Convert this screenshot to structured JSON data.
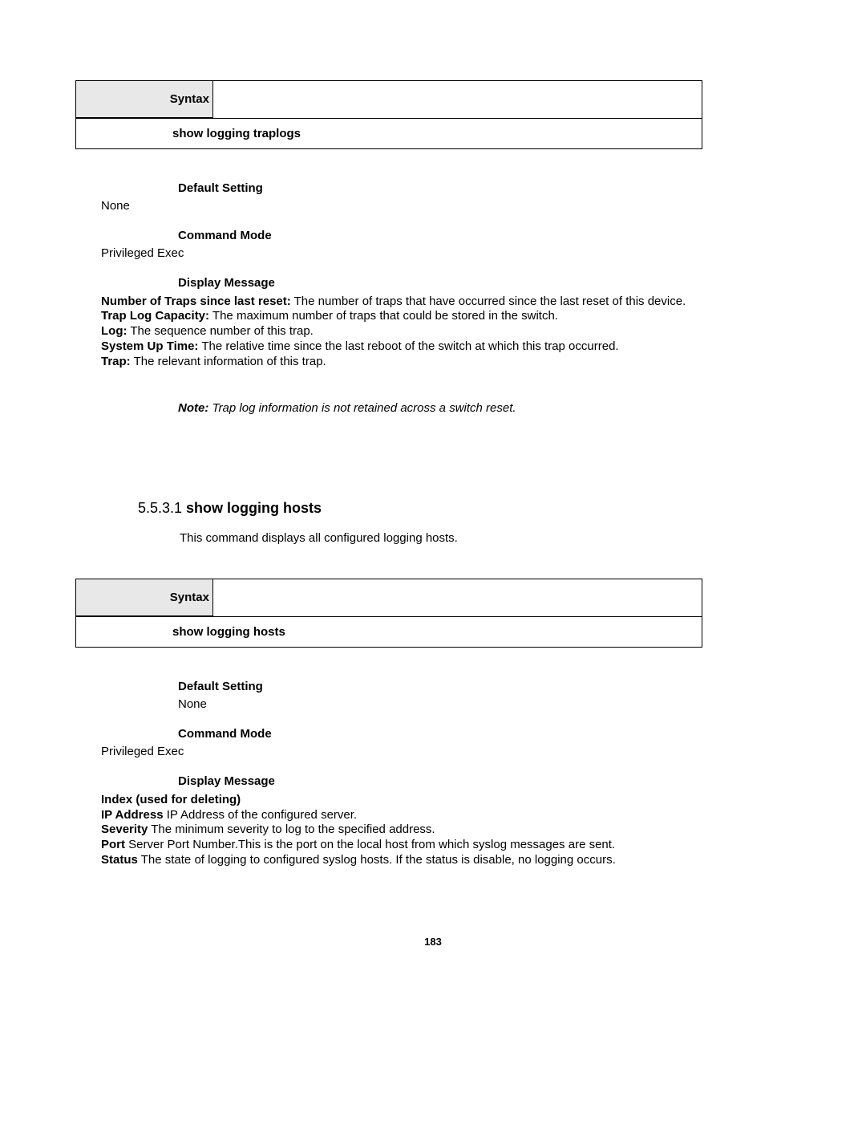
{
  "syntax1": {
    "label": "Syntax",
    "command": "show logging traplogs"
  },
  "default1": {
    "label": "Default Setting",
    "value": "None"
  },
  "mode1": {
    "label": "Command Mode",
    "value": "Privileged Exec"
  },
  "display1": {
    "label": "Display Message",
    "rows": {
      "num_traps_label": "Number of Traps since last reset:",
      "num_traps_text": " The number of traps that have occurred since the last reset of this device.",
      "capacity_label": "Trap Log Capacity:",
      "capacity_text": " The maximum number of traps that could be stored in the switch.",
      "log_label": "Log:",
      "log_text": " The sequence number of this trap.",
      "uptime_label": "System Up Time:",
      "uptime_text": " The relative time since the last reboot of the switch at which this trap occurred.",
      "trap_label": "Trap:",
      "trap_text": " The relevant information of this trap."
    }
  },
  "note": {
    "label": "Note:",
    "text": " Trap log information is not retained across a switch reset."
  },
  "subsection": {
    "number": "5.5.3.1 ",
    "title": "show logging hosts",
    "desc": "This command displays all configured logging hosts."
  },
  "syntax2": {
    "label": "Syntax",
    "command": "show logging hosts"
  },
  "default2": {
    "label": "Default Setting",
    "value": "None"
  },
  "mode2": {
    "label": "Command Mode",
    "value": "Privileged Exec"
  },
  "display2": {
    "label": "Display Message",
    "rows": {
      "index_label": "Index (used for deleting)",
      "ip_label": "IP Address",
      "ip_text": " IP Address of the configured server.",
      "severity_label": "Severity",
      "severity_text": " The minimum severity to log to the specified address.",
      "port_label": "Port",
      "port_text": " Server Port Number.This is the port on the local host from which syslog messages are sent.",
      "status_label": "Status",
      "status_text": " The state of logging to configured syslog hosts. If the status is disable, no logging occurs."
    }
  },
  "pagenum": "183"
}
